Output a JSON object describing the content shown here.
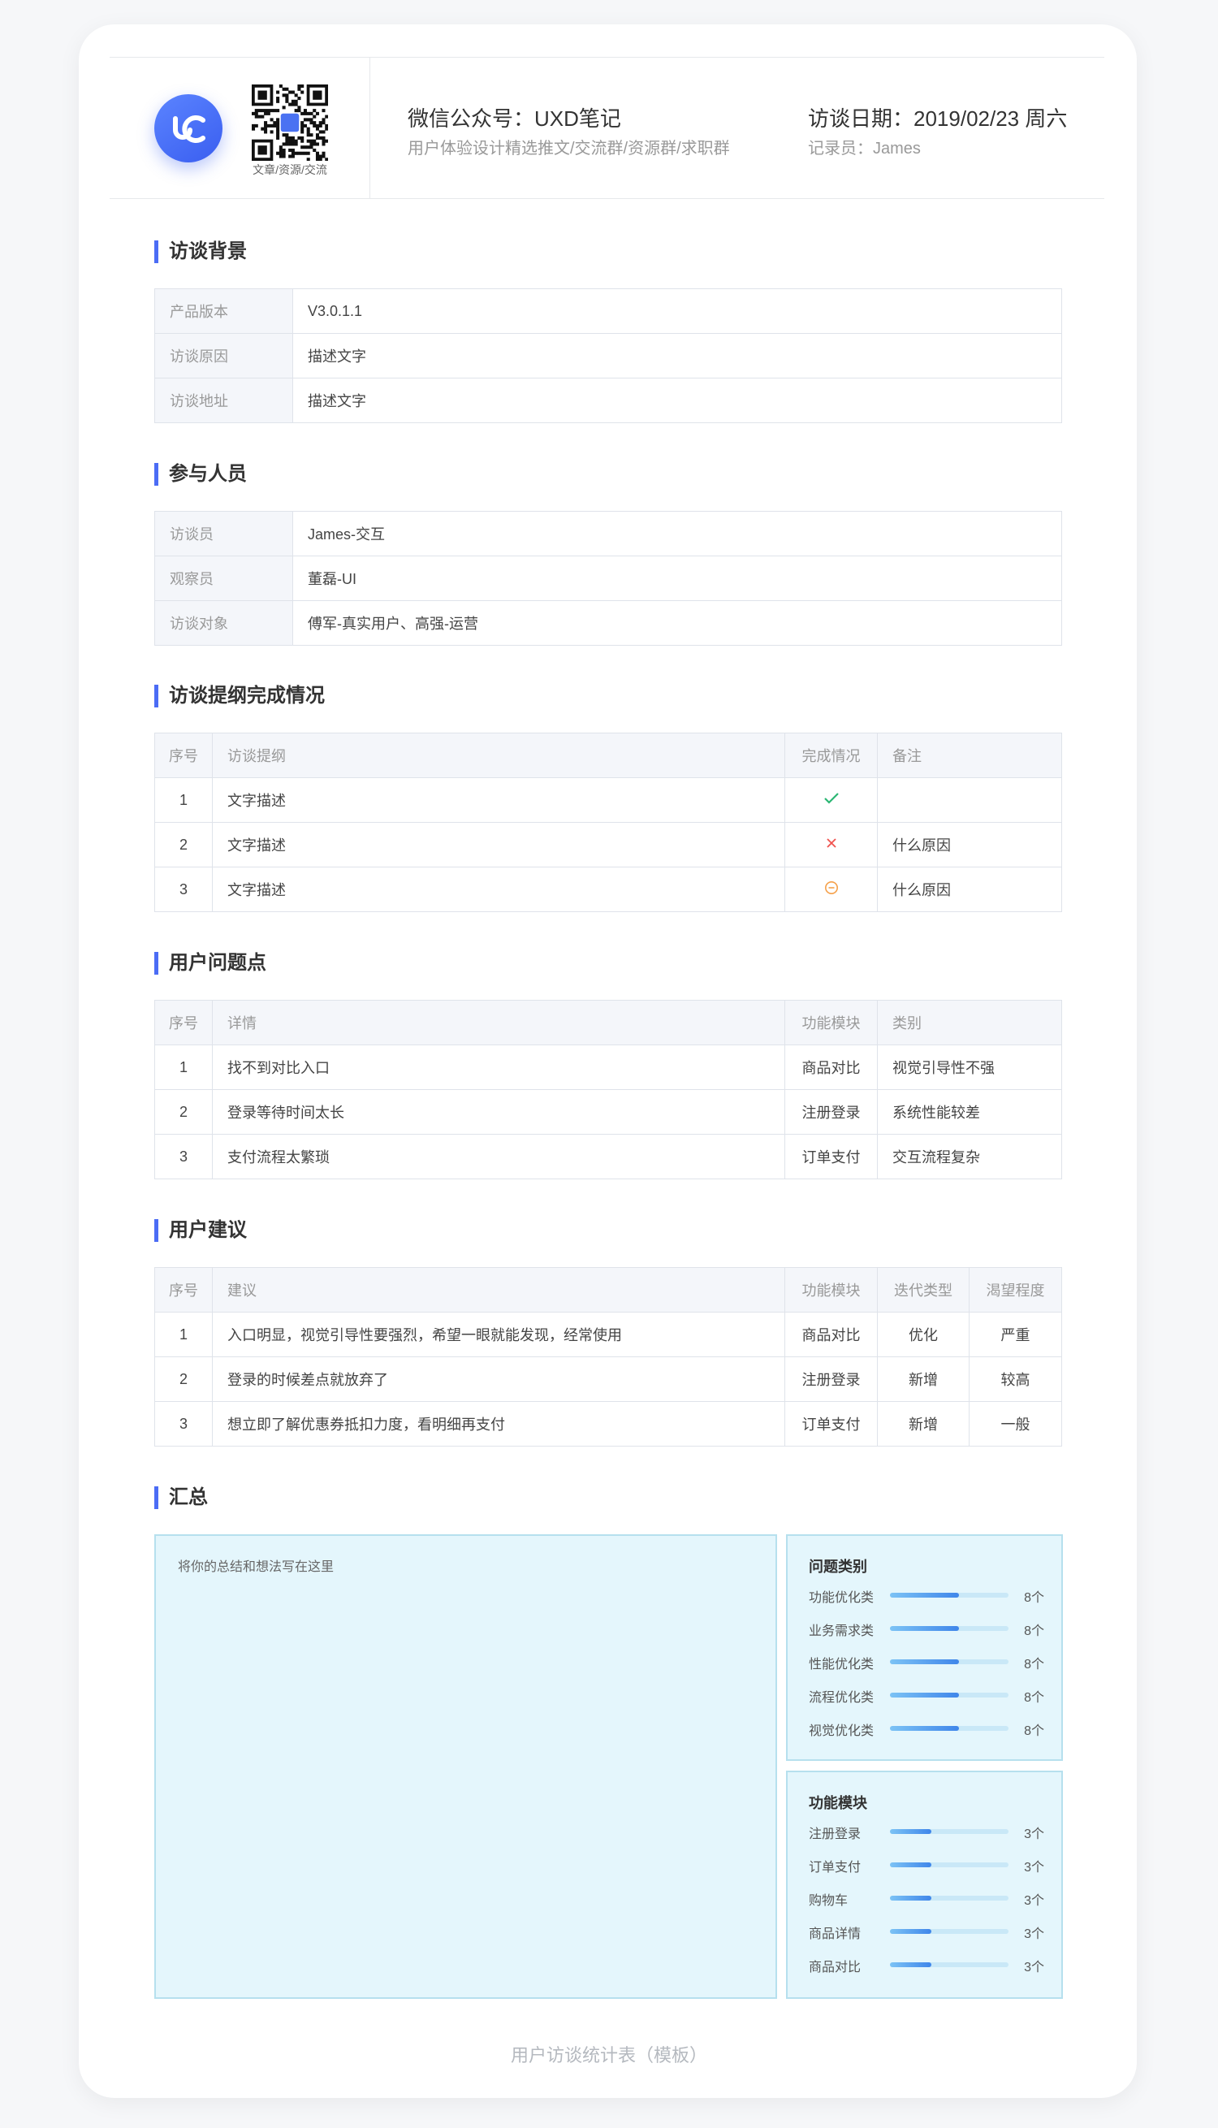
{
  "header": {
    "qr_caption": "文章/资源/交流",
    "wechat_title": "微信公众号：UXD笔记",
    "wechat_subtitle": "用户体验设计精选推文/交流群/资源群/求职群",
    "date": "访谈日期：2019/02/23 周六",
    "recorder": "记录员：James"
  },
  "background": {
    "title": "访谈背景",
    "rows": [
      {
        "key": "产品版本",
        "value": "V3.0.1.1"
      },
      {
        "key": "访谈原因",
        "value": "描述文字"
      },
      {
        "key": "访谈地址",
        "value": "描述文字"
      }
    ]
  },
  "participants": {
    "title": "参与人员",
    "rows": [
      {
        "key": "访谈员",
        "value": "James-交互"
      },
      {
        "key": "观察员",
        "value": "董磊-UI"
      },
      {
        "key": "访谈对象",
        "value": "傅军-真实用户、高强-运营"
      }
    ]
  },
  "outline": {
    "title": "访谈提纲完成情况",
    "headers": [
      "序号",
      "访谈提纲",
      "完成情况",
      "备注"
    ],
    "rows": [
      {
        "no": "1",
        "text": "文字描述",
        "status": "check-icon",
        "note": ""
      },
      {
        "no": "2",
        "text": "文字描述",
        "status": "cross-icon",
        "note": "什么原因"
      },
      {
        "no": "3",
        "text": "文字描述",
        "status": "minus-circle-icon",
        "note": "什么原因"
      }
    ]
  },
  "issues": {
    "title": "用户问题点",
    "headers": [
      "序号",
      "详情",
      "功能模块",
      "类别"
    ],
    "rows": [
      {
        "no": "1",
        "detail": "找不到对比入口",
        "module": "商品对比",
        "category": "视觉引导性不强"
      },
      {
        "no": "2",
        "detail": "登录等待时间太长",
        "module": "注册登录",
        "category": "系统性能较差"
      },
      {
        "no": "3",
        "detail": "支付流程太繁琐",
        "module": "订单支付",
        "category": "交互流程复杂"
      }
    ]
  },
  "suggestions": {
    "title": "用户建议",
    "headers": [
      "序号",
      "建议",
      "功能模块",
      "迭代类型",
      "渴望程度"
    ],
    "rows": [
      {
        "no": "1",
        "text": "入口明显，视觉引导性要强烈，希望一眼就能发现，经常使用",
        "module": "商品对比",
        "type": "优化",
        "level": "严重"
      },
      {
        "no": "2",
        "text": "登录的时候差点就放弃了",
        "module": "注册登录",
        "type": "新增",
        "level": "较高"
      },
      {
        "no": "3",
        "text": "想立即了解优惠券抵扣力度，看明细再支付",
        "module": "订单支付",
        "type": "新增",
        "level": "一般"
      }
    ]
  },
  "summary": {
    "title": "汇总",
    "placeholder": "将你的总结和想法写在这里",
    "issue_types": {
      "title": "问题类别",
      "rows": [
        {
          "label": "功能优化类",
          "count": "8个",
          "fraction": 0.58
        },
        {
          "label": "业务需求类",
          "count": "8个",
          "fraction": 0.58
        },
        {
          "label": "性能优化类",
          "count": "8个",
          "fraction": 0.58
        },
        {
          "label": "流程优化类",
          "count": "8个",
          "fraction": 0.58
        },
        {
          "label": "视觉优化类",
          "count": "8个",
          "fraction": 0.58
        }
      ]
    },
    "modules": {
      "title": "功能模块",
      "rows": [
        {
          "label": "注册登录",
          "count": "3个",
          "fraction": 0.35
        },
        {
          "label": "订单支付",
          "count": "3个",
          "fraction": 0.35
        },
        {
          "label": "购物车",
          "count": "3个",
          "fraction": 0.35
        },
        {
          "label": "商品详情",
          "count": "3个",
          "fraction": 0.35
        },
        {
          "label": "商品对比",
          "count": "3个",
          "fraction": 0.35
        }
      ]
    }
  },
  "footer": "用户访谈统计表（模板）",
  "colors": {
    "accent": "#4b6cf5",
    "check": "#2bb673",
    "cross": "#f0524e",
    "partial": "#f5a049"
  }
}
